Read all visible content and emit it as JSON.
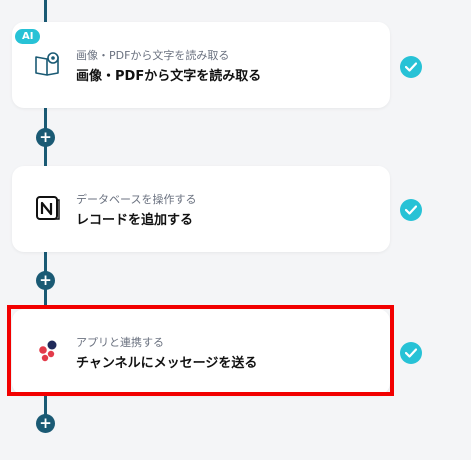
{
  "steps": [
    {
      "badge": "AI",
      "subtitle": "画像・PDFから文字を読み取る",
      "title": "画像・PDFから文字を読み取る",
      "icon": "book-ocr-icon",
      "status": "completed"
    },
    {
      "subtitle": "データベースを操作する",
      "title": "レコードを追加する",
      "icon": "notion-logo-icon",
      "status": "completed"
    },
    {
      "subtitle": "アプリと連携する",
      "title": "チャンネルにメッセージを送る",
      "icon": "app-dots-icon",
      "status": "completed",
      "highlighted": true
    }
  ],
  "add_button_label": "+",
  "colors": {
    "connector": "#1a5a74",
    "check": "#27c2d6",
    "highlight": "#f20000",
    "background": "#f4f5f7"
  }
}
